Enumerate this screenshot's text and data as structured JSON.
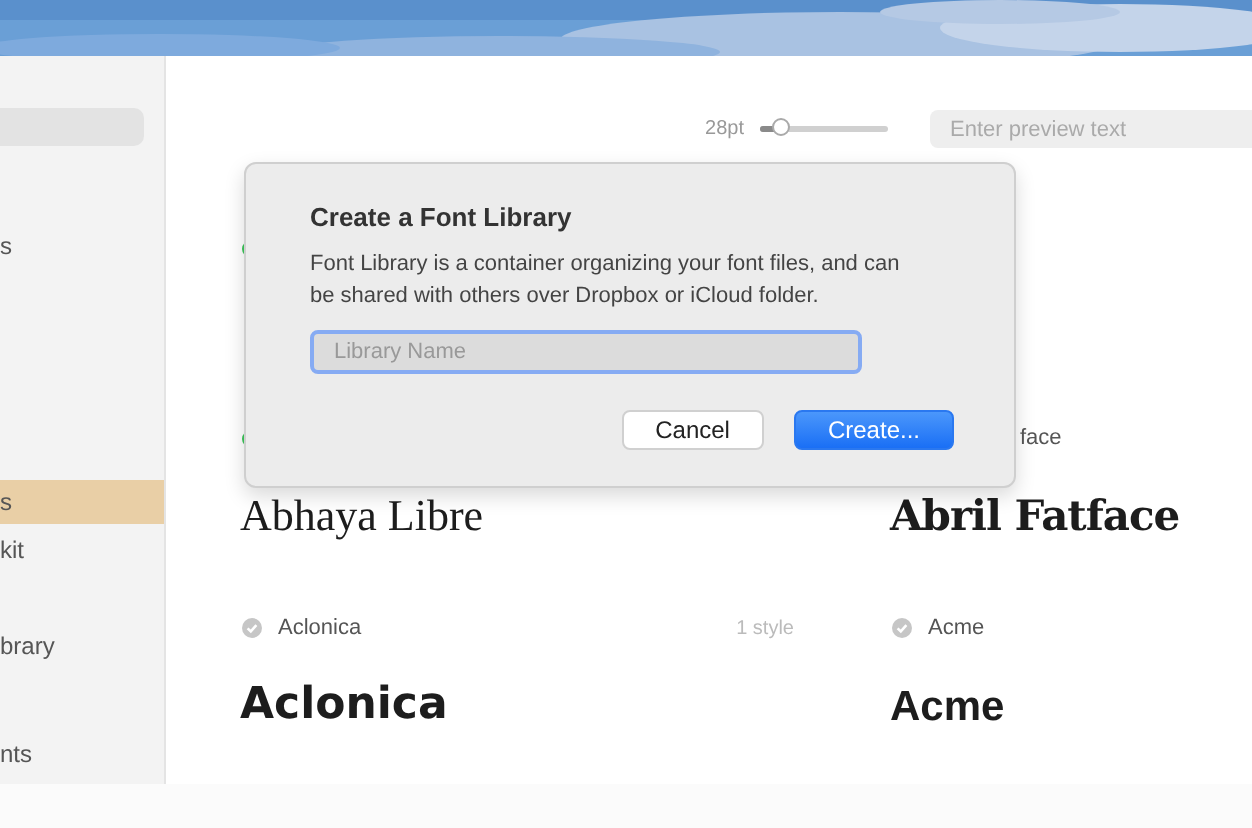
{
  "sidebar": {
    "items": [
      {
        "label": "s",
        "selected": false
      },
      {
        "label": "s",
        "selected": true
      },
      {
        "label": "kit",
        "selected": false
      },
      {
        "label": "brary",
        "selected": false
      },
      {
        "label": "nts",
        "selected": false
      }
    ]
  },
  "toolbar": {
    "size_label": "28pt",
    "size_slider": {
      "level": 0.17
    },
    "preview_field": {
      "placeholder": "Enter preview text"
    }
  },
  "font_rows": [
    {
      "cards": [
        {
          "active": true
        }
      ]
    },
    {
      "cards": [
        {
          "active": true,
          "sample": "Abhaya Libre",
          "kind": "serif"
        },
        {
          "label": "face",
          "sample": "Abril Fatface",
          "kind": "fatface"
        }
      ]
    },
    {
      "cards": [
        {
          "active": false,
          "label": "Aclonica",
          "styles": "1 style",
          "sample": "Aclonica",
          "kind": "decorative"
        },
        {
          "active": false,
          "label": "Acme",
          "sample": "Acme",
          "kind": "grotesque"
        }
      ]
    }
  ],
  "dialog": {
    "title": "Create a Font Library",
    "message": "Font Library is a container organizing your font files, and can be shared with others over Dropbox or iCloud folder.",
    "name_field": {
      "placeholder": "Library Name"
    },
    "buttons": [
      {
        "label": "Cancel",
        "kind": "secondary"
      },
      {
        "label": "Create...",
        "kind": "primary"
      }
    ]
  }
}
